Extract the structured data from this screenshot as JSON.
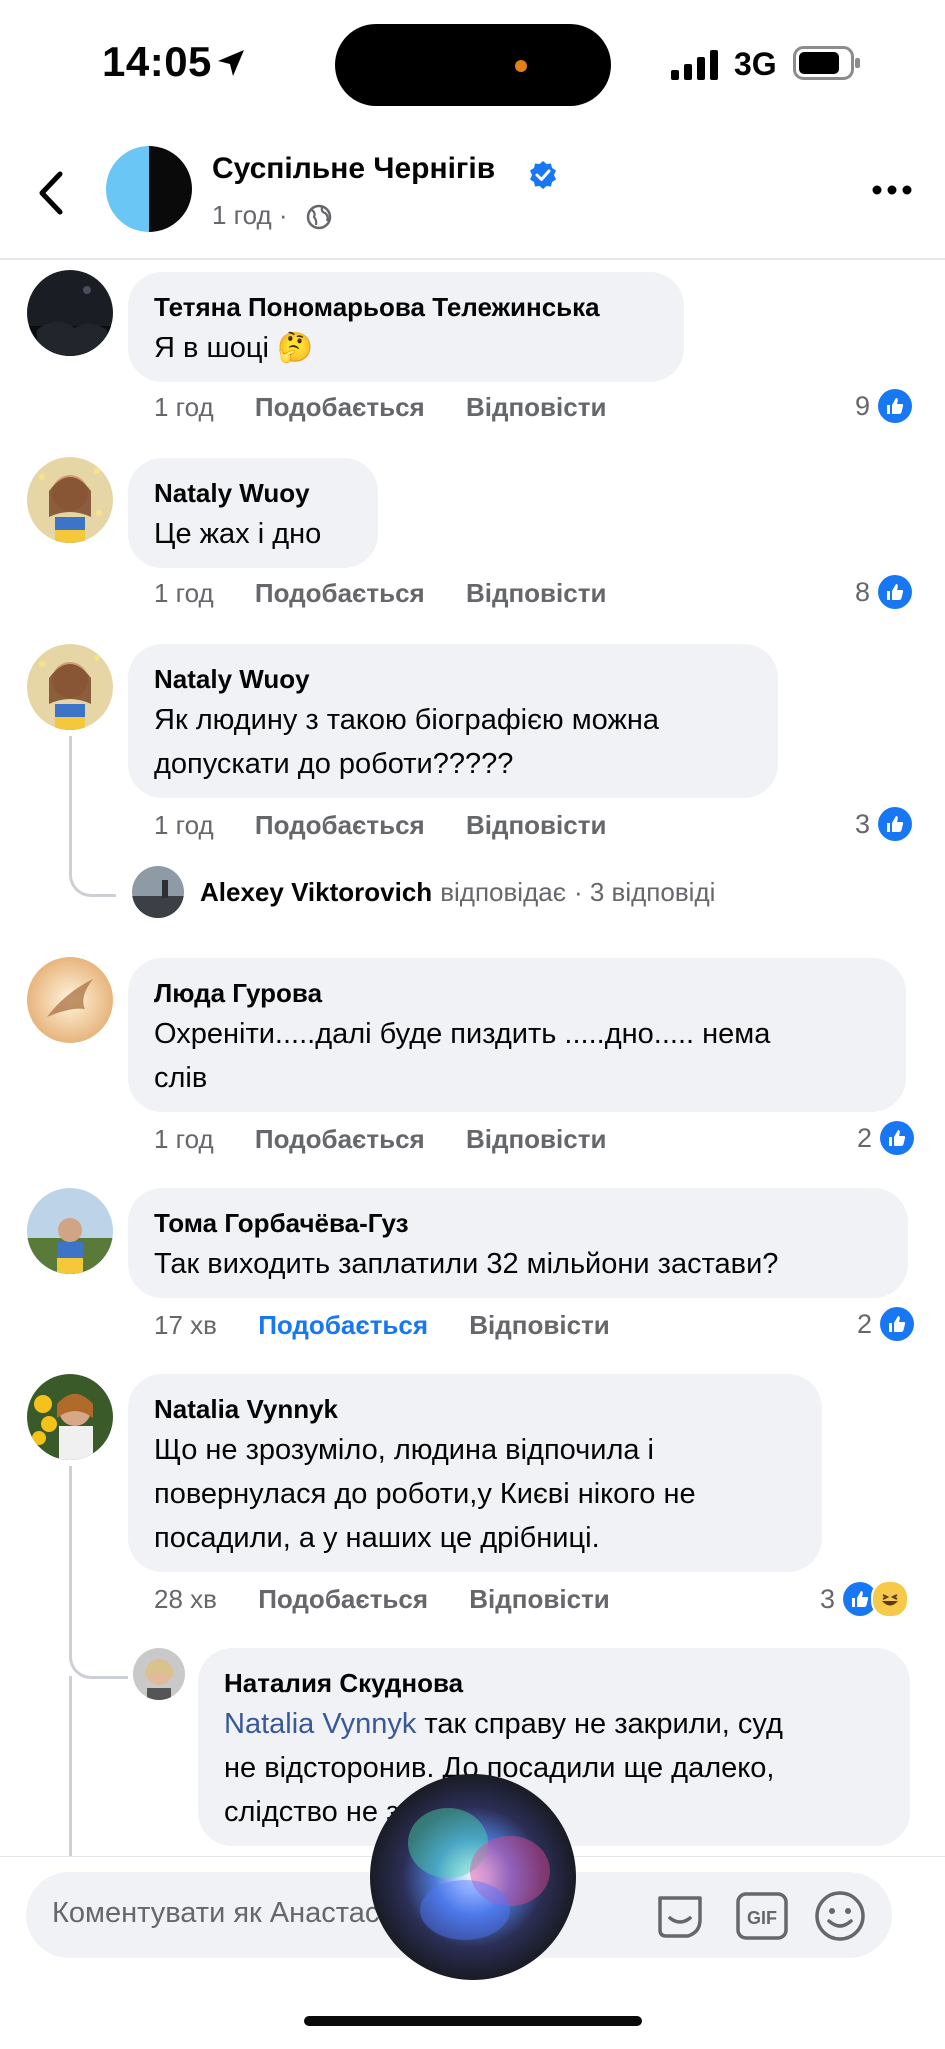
{
  "status_bar": {
    "time": "14:05",
    "network": "3G"
  },
  "header": {
    "page_name": "Суспільне Чернігів",
    "time": "1 год",
    "separator": "·"
  },
  "labels": {
    "like": "Подобається",
    "reply": "Відповісти"
  },
  "comments": [
    {
      "name": "Тетяна Пономарьова Тележинська",
      "text": "Я в шоці 🤔",
      "time": "1 год",
      "likes": "9"
    },
    {
      "name": "Nataly Wuoy",
      "text": "Це жах і дно",
      "time": "1 год",
      "likes": "8"
    },
    {
      "name": "Nataly Wuoy",
      "text_lines": [
        "Як людину з такою біографією можна",
        "допускати до роботи?????"
      ],
      "time": "1 год",
      "likes": "3"
    },
    {
      "name": "Люда Гурова",
      "text_lines": [
        "Охреніти.....далі буде пиздить .....дно..... нема",
        "слів"
      ],
      "time": "1 год",
      "likes": "2"
    },
    {
      "name": "Тома Горбачёва-Гуз",
      "text": "Так виходить заплатили 32 мільйони застави?",
      "time": "17 хв",
      "likes": "2"
    },
    {
      "name": "Natalia Vynnyk",
      "text_lines": [
        "Що не зрозуміло, людина відпочила і",
        "повернулася до роботи,у Києві нікого не",
        "посадили, а у наших це дрібниці."
      ],
      "time": "28 хв",
      "likes": "3"
    }
  ],
  "reply_summary": {
    "name": "Alexey Viktorovich",
    "verb": "відповідає",
    "count": "· 3 відповіді"
  },
  "nested_reply": {
    "name": "Наталия Скуднова",
    "mention": "Natalia Vynnyk",
    "line1_rest": " так справу не закрили, суд",
    "line2": "не відсторонив. До посадили ще далеко,",
    "line3": "слідство не закінчено."
  },
  "composer": {
    "placeholder": "Коментувати як Анастасія Шепел..."
  },
  "colors": {
    "accent": "#1877f2",
    "bubble": "#f0f2f5",
    "muted": "#65676b"
  }
}
